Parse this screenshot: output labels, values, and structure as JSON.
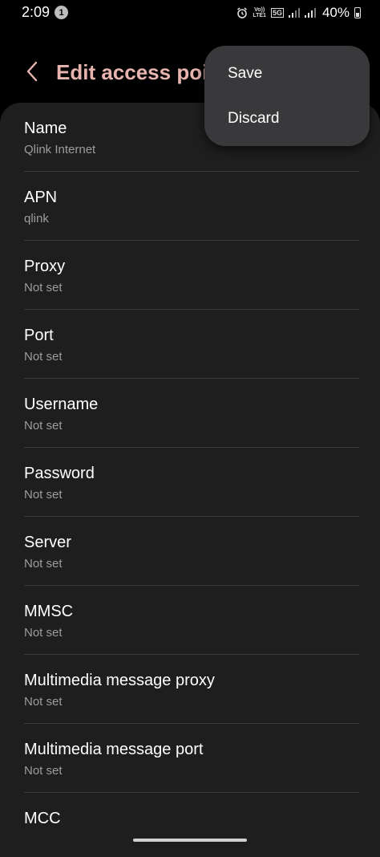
{
  "status_bar": {
    "time": "2:09",
    "notification_count": "1",
    "volte_top": "Vo))",
    "volte_bottom": "LTE1",
    "network": "5G",
    "battery_percent": "40%"
  },
  "header": {
    "title": "Edit access point",
    "back_icon": "chevron-left-icon"
  },
  "menu": {
    "save_label": "Save",
    "discard_label": "Discard"
  },
  "fields": [
    {
      "label": "Name",
      "value": "Qlink Internet"
    },
    {
      "label": "APN",
      "value": "qlink"
    },
    {
      "label": "Proxy",
      "value": "Not set"
    },
    {
      "label": "Port",
      "value": "Not set"
    },
    {
      "label": "Username",
      "value": "Not set"
    },
    {
      "label": "Password",
      "value": "Not set"
    },
    {
      "label": "Server",
      "value": "Not set"
    },
    {
      "label": "MMSC",
      "value": "Not set"
    },
    {
      "label": "Multimedia message proxy",
      "value": "Not set"
    },
    {
      "label": "Multimedia message port",
      "value": "Not set"
    },
    {
      "label": "MCC",
      "value": ""
    }
  ],
  "colors": {
    "title_accent": "#e8b4b0",
    "card_background": "#1e1e1f",
    "menu_background": "#39393b",
    "secondary_text": "#9d9d9f"
  }
}
